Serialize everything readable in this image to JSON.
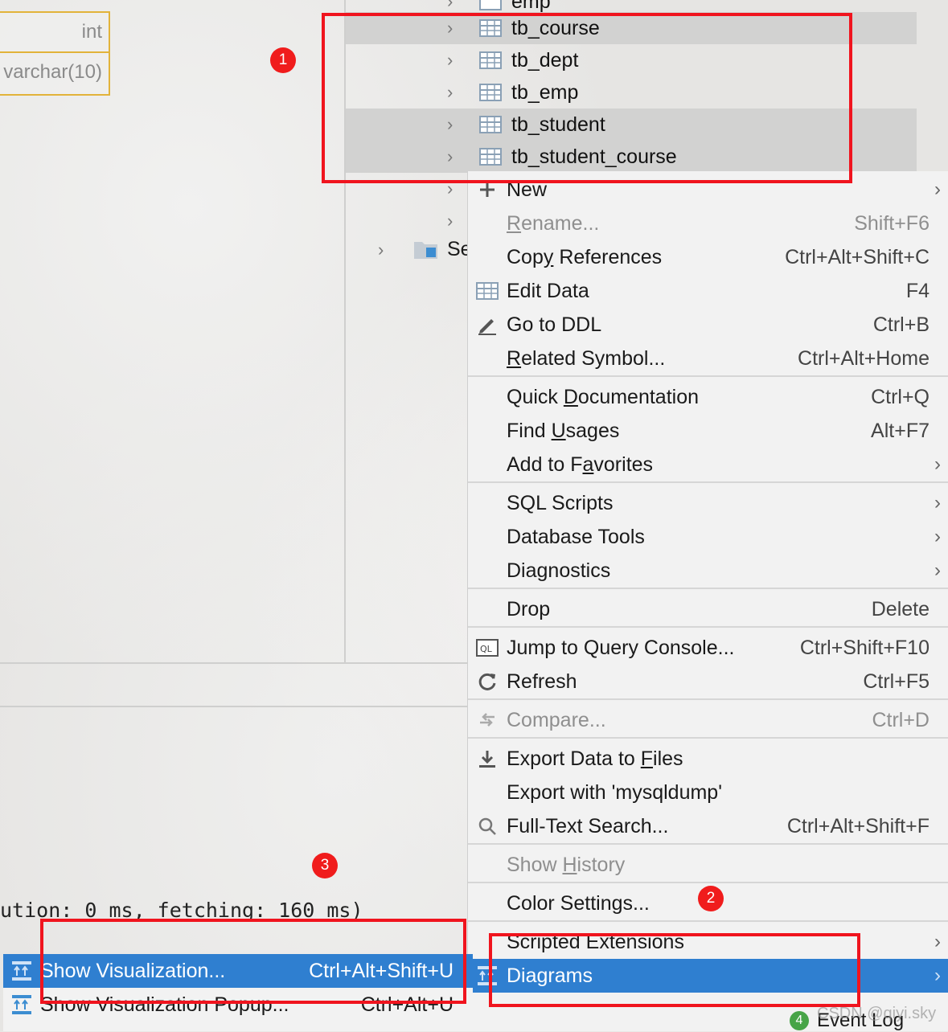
{
  "schema_box": {
    "rows": [
      "int",
      "varchar(10)"
    ]
  },
  "tree": {
    "partial_top_label": "emp",
    "items": [
      {
        "label": "tb_course",
        "selected": true
      },
      {
        "label": "tb_dept",
        "selected": false
      },
      {
        "label": "tb_emp",
        "selected": false
      },
      {
        "label": "tb_student",
        "selected": true
      },
      {
        "label": "tb_student_course",
        "selected": true
      }
    ],
    "partial_node_label": "Se"
  },
  "context_menu": {
    "items": [
      {
        "id": "new",
        "label": "New",
        "shortcut": "",
        "submenu": true,
        "disabled": false,
        "icon": "plus-icon"
      },
      {
        "id": "rename",
        "label_pre": "",
        "mnemonic": "R",
        "label_post": "ename...",
        "shortcut": "Shift+F6",
        "disabled": true
      },
      {
        "id": "copy-references",
        "label_pre": "Cop",
        "mnemonic": "y",
        "label_post": " References",
        "shortcut": "Ctrl+Alt+Shift+C"
      },
      {
        "id": "edit-data",
        "label": "Edit Data",
        "shortcut": "F4",
        "icon": "table-icon"
      },
      {
        "id": "go-to-ddl",
        "label": "Go to DDL",
        "shortcut": "Ctrl+B",
        "icon": "pencil-icon"
      },
      {
        "id": "related-symbol",
        "label_pre": "",
        "mnemonic": "R",
        "label_post": "elated Symbol...",
        "shortcut": "Ctrl+Alt+Home"
      },
      {
        "id": "quick-documentation",
        "label_pre": "Quick ",
        "mnemonic": "D",
        "label_post": "ocumentation",
        "shortcut": "Ctrl+Q"
      },
      {
        "id": "find-usages",
        "label_pre": "Find ",
        "mnemonic": "U",
        "label_post": "sages",
        "shortcut": "Alt+F7"
      },
      {
        "id": "add-to-favorites",
        "label_pre": "Add to F",
        "mnemonic": "a",
        "label_post": "vorites",
        "submenu": true
      },
      {
        "id": "sql-scripts",
        "label": "SQL Scripts",
        "submenu": true
      },
      {
        "id": "database-tools",
        "label": "Database Tools",
        "submenu": true
      },
      {
        "id": "diagnostics",
        "label": "Diagnostics",
        "submenu": true
      },
      {
        "id": "drop",
        "label": "Drop",
        "shortcut": "Delete"
      },
      {
        "id": "jump-to-query-console",
        "label": "Jump to Query Console...",
        "shortcut": "Ctrl+Shift+F10",
        "icon": "ql-icon"
      },
      {
        "id": "refresh",
        "label": "Refresh",
        "shortcut": "Ctrl+F5",
        "icon": "refresh-icon"
      },
      {
        "id": "compare",
        "label": "Compare...",
        "shortcut": "Ctrl+D",
        "disabled": true,
        "icon": "compare-icon"
      },
      {
        "id": "export-data-to-files",
        "label_pre": "Export Data to ",
        "mnemonic": "F",
        "label_post": "iles",
        "icon": "download-icon"
      },
      {
        "id": "export-mysqldump",
        "label": "Export with 'mysqldump'"
      },
      {
        "id": "full-text-search",
        "label": "Full-Text Search...",
        "shortcut": "Ctrl+Alt+Shift+F",
        "icon": "search-icon"
      },
      {
        "id": "show-history",
        "label_pre": "Show ",
        "mnemonic": "H",
        "label_post": "istory",
        "disabled": true
      },
      {
        "id": "color-settings",
        "label": "Color Settings..."
      },
      {
        "id": "scripted-extensions",
        "label": "Scripted Extensions",
        "submenu": true
      },
      {
        "id": "diagrams",
        "label": "Diagrams",
        "submenu": true,
        "active": true,
        "icon": "diagram-icon"
      }
    ]
  },
  "popup": {
    "items": [
      {
        "label": "Show Visualization...",
        "shortcut": "Ctrl+Alt+Shift+U",
        "active": true
      },
      {
        "label": "Show Visualization Popup...",
        "shortcut": "Ctrl+Alt+U",
        "active": false
      }
    ]
  },
  "console": {
    "text": "ution: 0 ms, fetching: 160 ms)"
  },
  "annotations": {
    "badge_1": "1",
    "badge_2": "2",
    "badge_3": "3"
  },
  "status_bar": {
    "event_log_count": "4",
    "event_log_label": "Event Log"
  },
  "watermark": "CSDN @qiyi.sky",
  "colors": {
    "highlight": "#2f7fd0",
    "annotation_red": "#f0141e",
    "schema_border": "#e2b33a"
  }
}
